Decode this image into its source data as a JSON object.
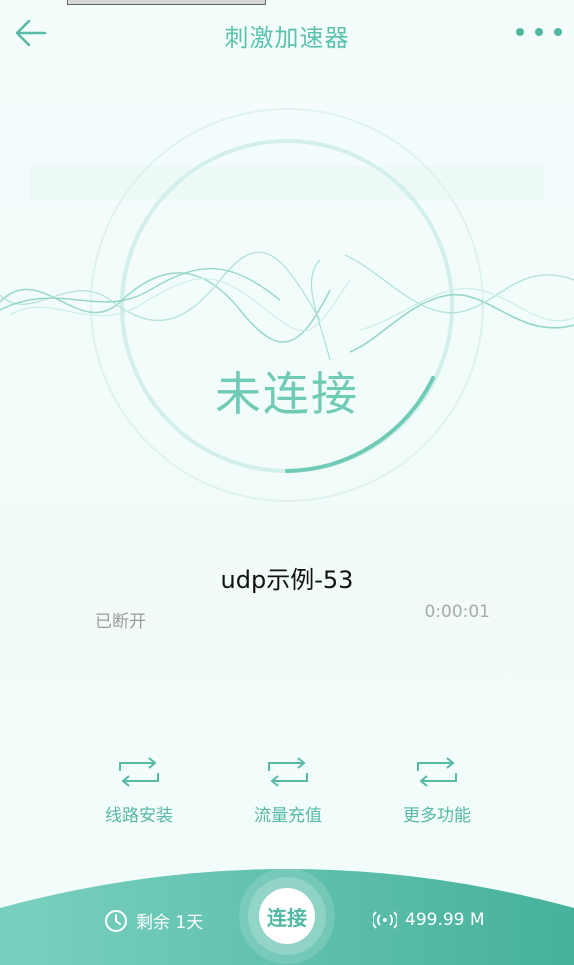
{
  "header": {
    "title": "刺激加速器",
    "back_icon": "arrow-left-icon",
    "more_icon": "more-dots-icon"
  },
  "status": {
    "label": "未连接"
  },
  "node": {
    "name": "udp示例-53",
    "state": "已断开",
    "timer": "0:00:01"
  },
  "actions": [
    {
      "label": "线路安装",
      "icon": "swap-icon"
    },
    {
      "label": "流量充值",
      "icon": "swap-icon"
    },
    {
      "label": "更多功能",
      "icon": "swap-icon"
    }
  ],
  "footer": {
    "remain_label": "剩余 1天",
    "remain_icon": "clock-icon",
    "connect_label": "连接",
    "traffic_label": "499.99 M",
    "traffic_icon": "signal-icon"
  },
  "colors": {
    "accent": "#4fb8a2",
    "accent_light": "#7fd0c0",
    "background": "#f2fcfb",
    "footer_start": "#7ad0c0",
    "footer_end": "#46b19b"
  }
}
